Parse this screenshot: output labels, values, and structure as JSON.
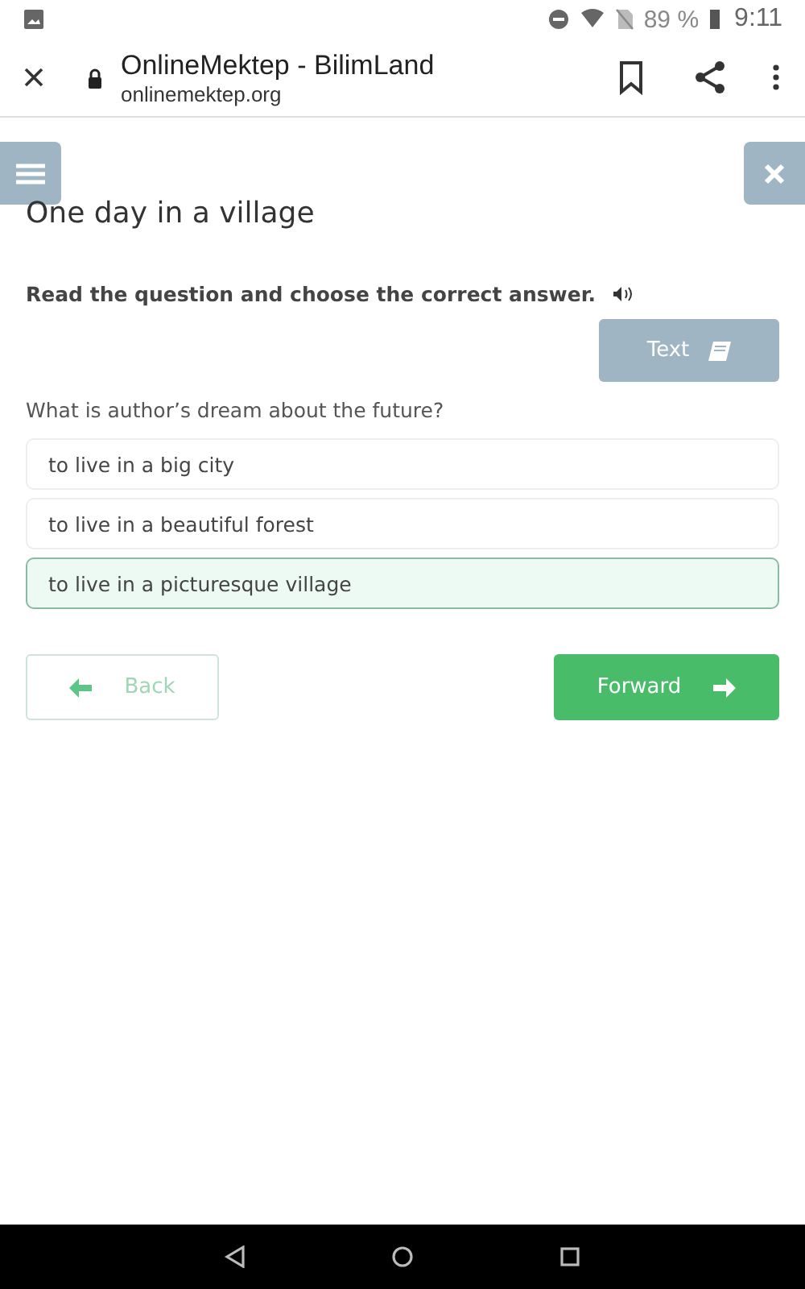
{
  "status_bar": {
    "battery": "89 %",
    "time": "9:11"
  },
  "browser": {
    "title": "OnlineMektep - BilimLand",
    "url": "onlinemektep.org"
  },
  "lesson": {
    "title": "One day in a village",
    "instruction": "Read the question and choose the correct answer.",
    "text_button": "Text",
    "question": "What is author’s dream about the future?",
    "answers": [
      {
        "label": "to live in a big city",
        "selected": false
      },
      {
        "label": "to live in a beautiful forest",
        "selected": false
      },
      {
        "label": "to live in a picturesque village",
        "selected": true
      }
    ],
    "back_button": "Back",
    "forward_button": "Forward"
  }
}
